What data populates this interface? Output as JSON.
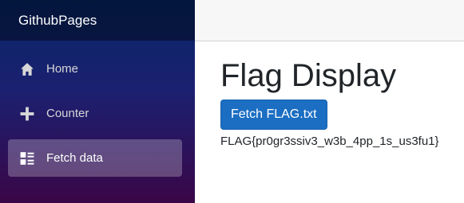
{
  "brand": {
    "title": "GithubPages"
  },
  "sidebar": {
    "items": [
      {
        "label": "Home",
        "icon": "home-icon",
        "active": false
      },
      {
        "label": "Counter",
        "icon": "plus-icon",
        "active": false
      },
      {
        "label": "Fetch data",
        "icon": "list-rich-icon",
        "active": true
      }
    ]
  },
  "main": {
    "title": "Flag Display",
    "button_label": "Fetch FLAG.txt",
    "flag_text": "FLAG{pr0gr3ssiv3_w3b_4pp_1s_us3fu1}"
  },
  "colors": {
    "button_bg": "#1b6ec2",
    "sidebar_top": "#052767",
    "sidebar_bottom": "#3a0647"
  }
}
